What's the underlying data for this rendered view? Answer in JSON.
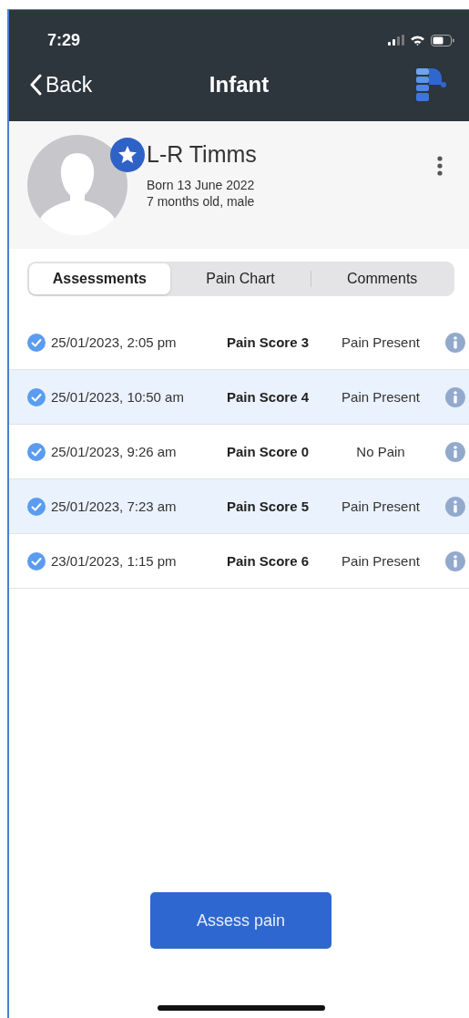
{
  "status_bar": {
    "time": "7:29"
  },
  "nav": {
    "back": "Back",
    "title": "Infant"
  },
  "patient": {
    "name": "L-R Timms",
    "born": "Born 13 June 2022",
    "age": "7 months old, male",
    "favorite": true
  },
  "tabs": [
    {
      "label": "Assessments",
      "selected": true
    },
    {
      "label": "Pain Chart",
      "selected": false
    },
    {
      "label": "Comments",
      "selected": false
    }
  ],
  "assessments": [
    {
      "date": "25/01/2023, 2:05 pm",
      "score": "Pain Score 3",
      "status": "Pain Present",
      "checked": true
    },
    {
      "date": "25/01/2023, 10:50 am",
      "score": "Pain Score 4",
      "status": "Pain Present",
      "checked": true
    },
    {
      "date": "25/01/2023, 9:26 am",
      "score": "Pain Score 0",
      "status": "No Pain",
      "checked": true
    },
    {
      "date": "25/01/2023, 7:23 am",
      "score": "Pain Score 5",
      "status": "Pain Present",
      "checked": true
    },
    {
      "date": "23/01/2023, 1:15 pm",
      "score": "Pain Score 6",
      "status": "Pain Present",
      "checked": true
    }
  ],
  "action_button": "Assess pain"
}
